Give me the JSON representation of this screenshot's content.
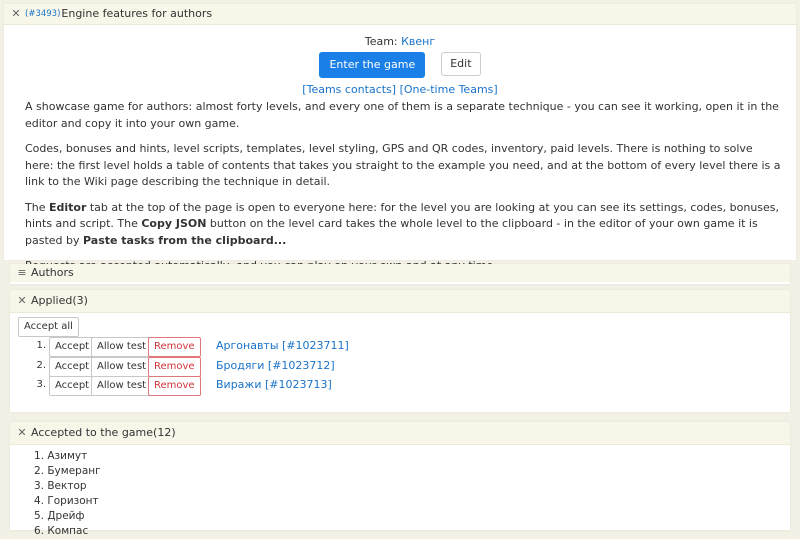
{
  "game": {
    "id": "(#3493)",
    "title": "Engine features for authors",
    "team_label": "Team:",
    "team_name": "Квенг",
    "enter_button": "Enter the game",
    "edit_button": "Edit",
    "teams_contacts": "[Teams contacts]",
    "one_time_teams": "[One-time Teams]"
  },
  "description": {
    "p1": "A showcase game for authors: almost forty levels, and every one of them is a separate technique - you can see it working, open it in the editor and copy it into your own game.",
    "p2": "Codes, bonuses and hints, level scripts, templates, level styling, GPS and QR codes, inventory, paid levels. There is nothing to solve here: the first level holds a table of contents that takes you straight to the example you need, and at the bottom of every level there is a link to the Wiki page describing the technique in detail.",
    "p3_a": "The ",
    "p3_editor": "Editor",
    "p3_b": " tab at the top of the page is open to everyone here: for the level you are looking at you can see its settings, codes, bonuses, hints and script. The ",
    "p3_copy": "Copy JSON",
    "p3_c": " button on the level card takes the whole level to the clipboard - in the editor of your own game it is pasted by ",
    "p3_paste": "Paste tasks from the clipboard...",
    "p4": "Requests are accepted automatically, and you can play on your own and at any time."
  },
  "authors": {
    "title": "Authors"
  },
  "applied": {
    "title": "Applied(3)",
    "accept_all": "Accept all",
    "accept": "Accept",
    "allow_test": "Allow test",
    "remove": "Remove",
    "items": [
      {
        "num": "1.",
        "name": "Аргонавты [#1023711]"
      },
      {
        "num": "2.",
        "name": "Бродяги [#1023712]"
      },
      {
        "num": "3.",
        "name": "Виражи [#1023713]"
      }
    ]
  },
  "accepted": {
    "title": "Accepted to the game(12)",
    "items": [
      "1. Азимут",
      "2. Бумеранг",
      "3. Вектор",
      "4. Горизонт",
      "5. Дрейф",
      "6. Компас"
    ]
  },
  "colors": {
    "accent": "#1a7fe6",
    "link": "#1a73c9",
    "remove": "#d0343a",
    "header_bg": "#f8f6e9",
    "page_bg": "#f3f1e6"
  },
  "icons": {
    "collapse": "close-icon",
    "menu": "menu-icon"
  }
}
